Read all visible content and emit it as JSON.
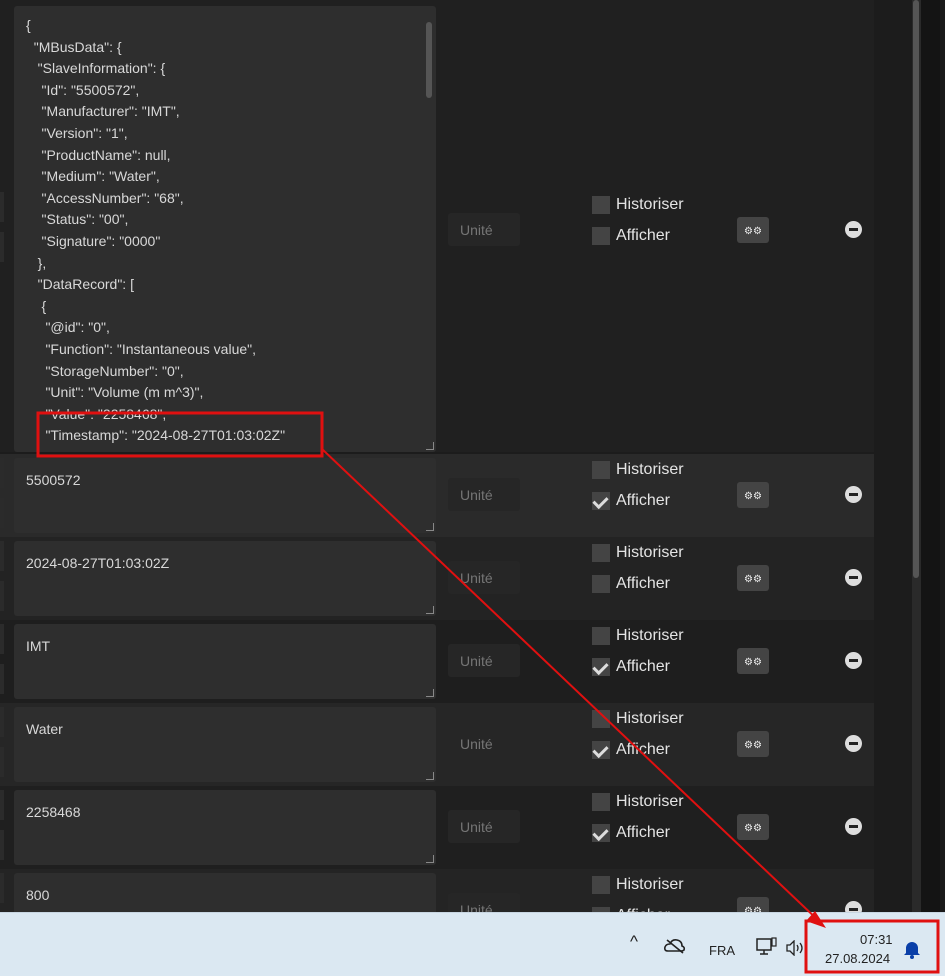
{
  "json_editor": {
    "text": "{\n  \"MBusData\": {\n   \"SlaveInformation\": {\n    \"Id\": \"5500572\",\n    \"Manufacturer\": \"IMT\",\n    \"Version\": \"1\",\n    \"ProductName\": null,\n    \"Medium\": \"Water\",\n    \"AccessNumber\": \"68\",\n    \"Status\": \"00\",\n    \"Signature\": \"0000\"\n   },\n   \"DataRecord\": [\n    {\n     \"@id\": \"0\",\n     \"Function\": \"Instantaneous value\",\n     \"StorageNumber\": \"0\",\n     \"Unit\": \"Volume (m m^3)\",\n     \"Value\": \"2258468\",\n     \"Timestamp\": \"2024-08-27T01:03:02Z\""
  },
  "labels": {
    "unit_placeholder": "Unité",
    "historiser": "Historiser",
    "afficher": "Afficher",
    "gear": "⚙⚙"
  },
  "rows": [
    {
      "value": "5500572",
      "historiser": false,
      "afficher": true
    },
    {
      "value": "2024-08-27T01:03:02Z",
      "historiser": false,
      "afficher": false
    },
    {
      "value": "IMT",
      "historiser": false,
      "afficher": true
    },
    {
      "value": "Water",
      "historiser": false,
      "afficher": true
    },
    {
      "value": "2258468",
      "historiser": false,
      "afficher": true
    },
    {
      "value": "800",
      "historiser": false,
      "afficher": false
    }
  ],
  "first_row": {
    "historiser": false,
    "afficher": false
  },
  "taskbar": {
    "chevron": "^",
    "language": "FRA",
    "time": "07:31",
    "date": "27.08.2024"
  },
  "colors": {
    "annotation": "#e01010",
    "bell": "#0a3fa8"
  }
}
